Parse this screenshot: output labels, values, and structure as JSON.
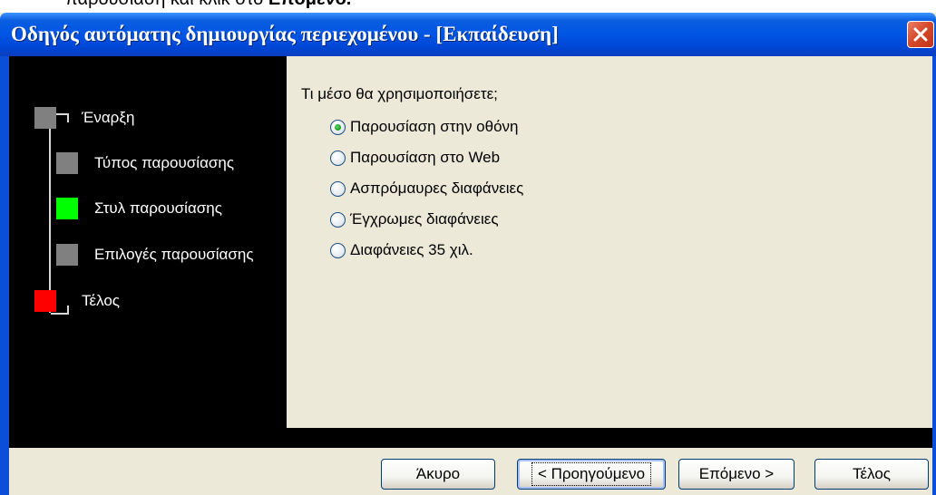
{
  "caption": {
    "text_plain": "παρουσίαση και κλικ στο ",
    "text_bold": "Επόμενο."
  },
  "window": {
    "title": "Οδηγός αυτόματης δημιουργίας περιεχομένου - [Εκπαίδευση]",
    "close_icon": "close-icon"
  },
  "steps": [
    {
      "label": "Έναρξη",
      "color": "#808080"
    },
    {
      "label": "Τύπος παρουσίασης",
      "color": "#808080"
    },
    {
      "label": "Στυλ παρουσίασης",
      "color": "#00ff00"
    },
    {
      "label": "Επιλογές παρουσίασης",
      "color": "#808080"
    },
    {
      "label": "Τέλος",
      "color": "#ff0000"
    }
  ],
  "question": "Τι μέσο θα χρησιμοποιήσετε;",
  "options": [
    {
      "label": "Παρουσίαση στην οθόνη",
      "selected": true
    },
    {
      "label": "Παρουσίαση στο Web",
      "selected": false
    },
    {
      "label": "Ασπρόμαυρες διαφάνειες",
      "selected": false
    },
    {
      "label": "Έγχρωμες διαφάνειες",
      "selected": false
    },
    {
      "label": "Διαφάνειες 35 χιλ.",
      "selected": false
    }
  ],
  "buttons": {
    "cancel": "Άκυρο",
    "back": "< Προηγούμενο",
    "next": "Επόμενο >",
    "finish": "Τέλος"
  },
  "colors": {
    "titlebar": "#0055e5",
    "panel": "#ece9d8",
    "accent_current": "#00ff00",
    "accent_end": "#ff0000"
  }
}
